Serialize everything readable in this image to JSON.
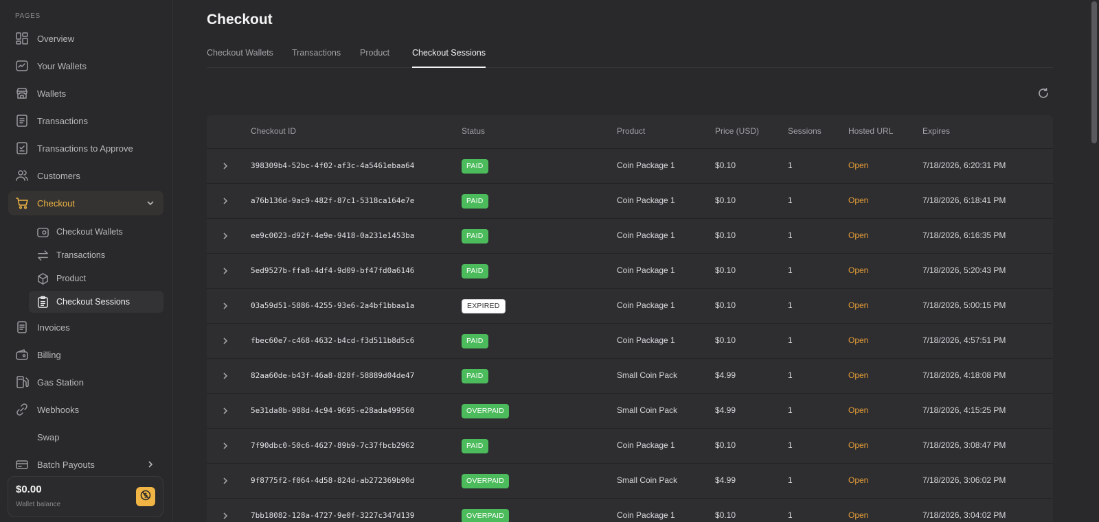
{
  "sidebar": {
    "section_label": "PAGES",
    "items": [
      {
        "label": "Overview",
        "icon": "grid-icon"
      },
      {
        "label": "Your Wallets",
        "icon": "wallet-chart-icon"
      },
      {
        "label": "Wallets",
        "icon": "store-icon"
      },
      {
        "label": "Transactions",
        "icon": "list-icon"
      },
      {
        "label": "Transactions to Approve",
        "icon": "check-list-icon"
      },
      {
        "label": "Customers",
        "icon": "users-icon"
      },
      {
        "label": "Checkout",
        "icon": "cart-icon"
      },
      {
        "label": "Invoices",
        "icon": "invoice-icon"
      },
      {
        "label": "Billing",
        "icon": "billing-wallet-icon"
      },
      {
        "label": "Gas Station",
        "icon": "gas-station-icon"
      },
      {
        "label": "Webhooks",
        "icon": "link-icon"
      },
      {
        "label": "Swap",
        "icon": "swap-icon"
      },
      {
        "label": "Batch Payouts",
        "icon": "payouts-icon"
      }
    ],
    "checkout_subitems": [
      {
        "label": "Checkout Wallets",
        "icon": "wallet-icon"
      },
      {
        "label": "Transactions",
        "icon": "arrows-icon"
      },
      {
        "label": "Product",
        "icon": "box-icon"
      },
      {
        "label": "Checkout Sessions",
        "icon": "clipboard-icon"
      }
    ],
    "wallet": {
      "amount": "$0.00",
      "label": "Wallet balance"
    }
  },
  "main": {
    "title": "Checkout",
    "tabs": [
      "Checkout Wallets",
      "Transactions",
      "Product",
      "Checkout Sessions"
    ],
    "active_tab": "Checkout Sessions",
    "table": {
      "headers": [
        "Checkout ID",
        "Status",
        "Product",
        "Price (USD)",
        "Sessions",
        "Hosted URL",
        "Expires"
      ],
      "rows": [
        {
          "id": "398309b4-52bc-4f02-af3c-4a5461ebaa64",
          "status": "PAID",
          "product": "Coin Package 1",
          "price": "$0.10",
          "sessions": "1",
          "url": "Open",
          "expires": "7/18/2026, 6:20:31 PM"
        },
        {
          "id": "a76b136d-9ac9-482f-87c1-5318ca164e7e",
          "status": "PAID",
          "product": "Coin Package 1",
          "price": "$0.10",
          "sessions": "1",
          "url": "Open",
          "expires": "7/18/2026, 6:18:41 PM"
        },
        {
          "id": "ee9c0023-d92f-4e9e-9418-0a231e1453ba",
          "status": "PAID",
          "product": "Coin Package 1",
          "price": "$0.10",
          "sessions": "1",
          "url": "Open",
          "expires": "7/18/2026, 6:16:35 PM"
        },
        {
          "id": "5ed9527b-ffa8-4df4-9d09-bf47fd0a6146",
          "status": "PAID",
          "product": "Coin Package 1",
          "price": "$0.10",
          "sessions": "1",
          "url": "Open",
          "expires": "7/18/2026, 5:20:43 PM"
        },
        {
          "id": "03a59d51-5886-4255-93e6-2a4bf1bbaa1a",
          "status": "EXPIRED",
          "product": "Coin Package 1",
          "price": "$0.10",
          "sessions": "1",
          "url": "Open",
          "expires": "7/18/2026, 5:00:15 PM"
        },
        {
          "id": "fbec60e7-c468-4632-b4cd-f3d511b8d5c6",
          "status": "PAID",
          "product": "Coin Package 1",
          "price": "$0.10",
          "sessions": "1",
          "url": "Open",
          "expires": "7/18/2026, 4:57:51 PM"
        },
        {
          "id": "82aa60de-b43f-46a8-828f-58889d04de47",
          "status": "PAID",
          "product": "Small Coin Pack",
          "price": "$4.99",
          "sessions": "1",
          "url": "Open",
          "expires": "7/18/2026, 4:18:08 PM"
        },
        {
          "id": "5e31da8b-988d-4c94-9695-e28ada499560",
          "status": "OVERPAID",
          "product": "Small Coin Pack",
          "price": "$4.99",
          "sessions": "1",
          "url": "Open",
          "expires": "7/18/2026, 4:15:25 PM"
        },
        {
          "id": "7f90dbc0-50c6-4627-89b9-7c37fbcb2962",
          "status": "PAID",
          "product": "Coin Package 1",
          "price": "$0.10",
          "sessions": "1",
          "url": "Open",
          "expires": "7/18/2026, 3:08:47 PM"
        },
        {
          "id": "9f8775f2-f064-4d58-824d-ab272369b90d",
          "status": "OVERPAID",
          "product": "Small Coin Pack",
          "price": "$4.99",
          "sessions": "1",
          "url": "Open",
          "expires": "7/18/2026, 3:06:02 PM"
        },
        {
          "id": "7bb18082-128a-4727-9e0f-3227c347d139",
          "status": "OVERPAID",
          "product": "Coin Package 1",
          "price": "$0.10",
          "sessions": "1",
          "url": "Open",
          "expires": "7/18/2026, 3:04:02 PM"
        }
      ]
    }
  },
  "colors": {
    "accent": "#f0b544",
    "paid": "#4cbb5c",
    "link": "#e09a36",
    "background": "#29292b"
  }
}
